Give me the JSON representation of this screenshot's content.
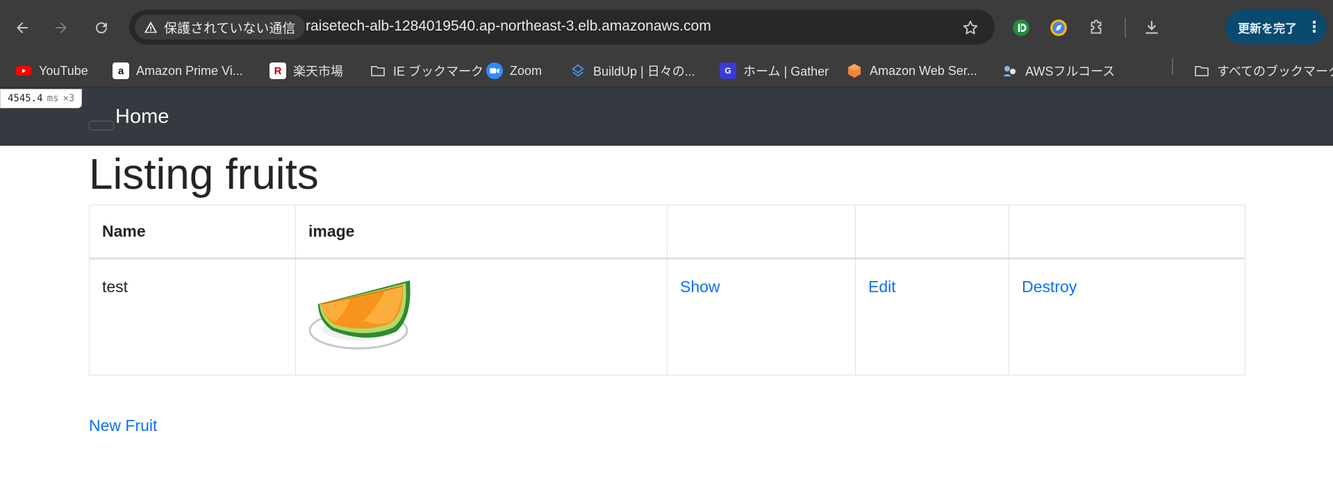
{
  "browser": {
    "security_label": "保護されていない通信",
    "url": "raisetech-alb-1284019540.ap-northeast-3.elb.amazonaws.com",
    "update_button": "更新を完了"
  },
  "bookmarks": [
    {
      "label": "YouTube",
      "icon": "youtube-icon"
    },
    {
      "label": "Amazon Prime Vi...",
      "icon": "amazon-icon"
    },
    {
      "label": "楽天市場",
      "icon": "rakuten-icon"
    },
    {
      "label": "IE ブックマーク",
      "icon": "folder-icon"
    },
    {
      "label": "Zoom",
      "icon": "zoom-icon"
    },
    {
      "label": "BuildUp | 日々の...",
      "icon": "buildup-icon"
    },
    {
      "label": "ホーム | Gather",
      "icon": "gather-icon"
    },
    {
      "label": "Amazon Web Ser...",
      "icon": "aws-icon"
    },
    {
      "label": "AWSフルコース",
      "icon": "awsfull-icon"
    },
    {
      "label": "すべてのブックマーク",
      "icon": "folder-icon"
    }
  ],
  "perf": {
    "value": "4545.4",
    "unit": "ms",
    "count": "×3"
  },
  "navbar": {
    "home": "Home"
  },
  "page": {
    "title": "Listing fruits"
  },
  "table": {
    "headers": [
      "Name",
      "image",
      "",
      "",
      ""
    ],
    "rows": [
      {
        "name": "test",
        "image": "melon",
        "show": "Show",
        "edit": "Edit",
        "destroy": "Destroy"
      }
    ]
  },
  "links": {
    "new_fruit": "New Fruit"
  },
  "colors": {
    "link": "#0d6efd",
    "navbar": "#343a40",
    "chrome": "#3c3c3c"
  }
}
